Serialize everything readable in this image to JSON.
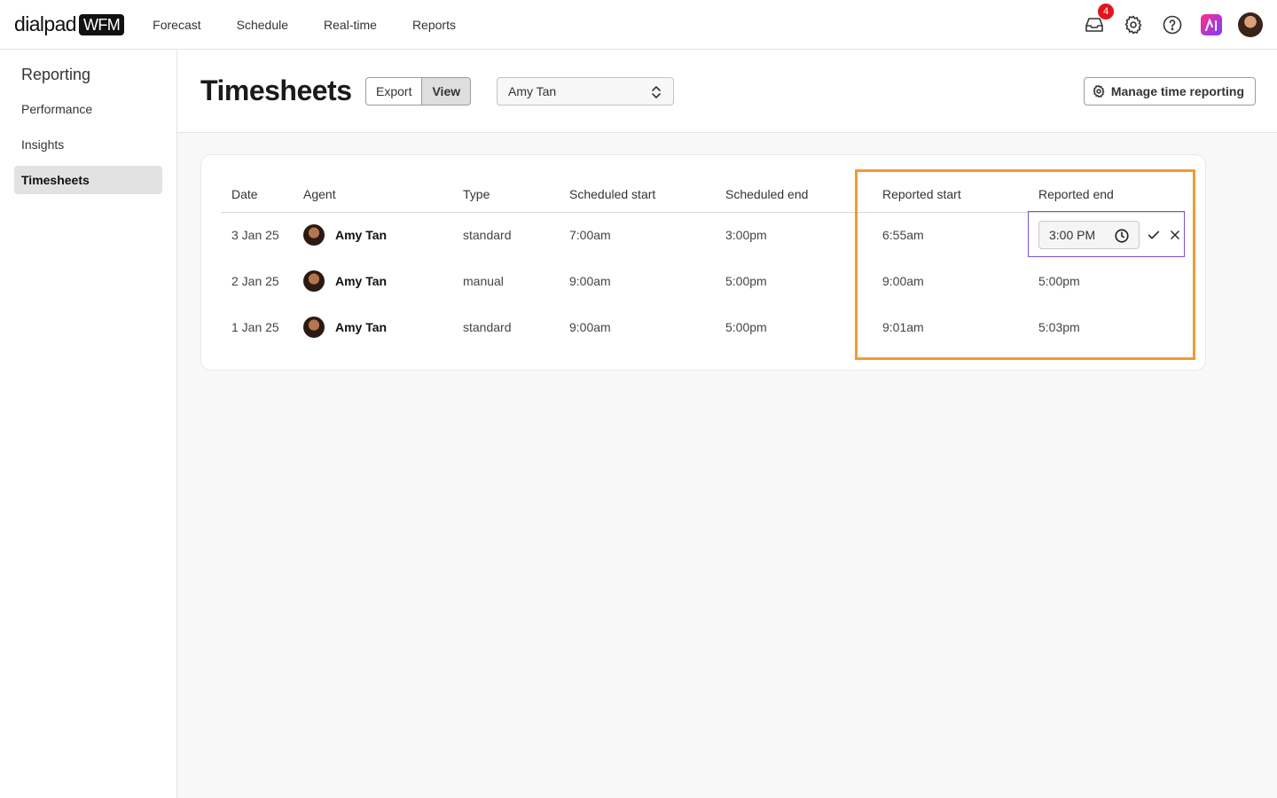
{
  "topbar": {
    "logo_word": "dialpad",
    "logo_badge": "WFM",
    "nav": [
      "Forecast",
      "Schedule",
      "Real-time",
      "Reports"
    ],
    "inbox_count": "4",
    "icons": [
      "inbox-icon",
      "gear-icon",
      "help-icon",
      "ai-icon",
      "user-avatar"
    ]
  },
  "sidebar": {
    "title": "Reporting",
    "items": [
      {
        "label": "Performance",
        "active": false
      },
      {
        "label": "Insights",
        "active": false
      },
      {
        "label": "Timesheets",
        "active": true
      }
    ]
  },
  "header": {
    "title": "Timesheets",
    "export_label": "Export",
    "view_label": "View",
    "agent_select": "Amy Tan",
    "manage_label": "Manage time reporting"
  },
  "table": {
    "columns": [
      "Date",
      "Agent",
      "Type",
      "Scheduled start",
      "Scheduled end",
      "Reported start",
      "Reported end"
    ],
    "rows": [
      {
        "date": "3 Jan 25",
        "agent": "Amy Tan",
        "type": "standard",
        "sched_start": "7:00am",
        "sched_end": "3:00pm",
        "rep_start": "6:55am",
        "rep_end": "3:00 PM"
      },
      {
        "date": "2 Jan 25",
        "agent": "Amy Tan",
        "type": "manual",
        "sched_start": "9:00am",
        "sched_end": "5:00pm",
        "rep_start": "9:00am",
        "rep_end": "5:00pm"
      },
      {
        "date": "1 Jan 25",
        "agent": "Amy Tan",
        "type": "standard",
        "sched_start": "9:00am",
        "sched_end": "5:00pm",
        "rep_start": "9:01am",
        "rep_end": "5:03pm"
      }
    ]
  },
  "colors": {
    "highlight": "#f39a33",
    "focus": "#7c52d8",
    "badge": "#e2141e"
  }
}
